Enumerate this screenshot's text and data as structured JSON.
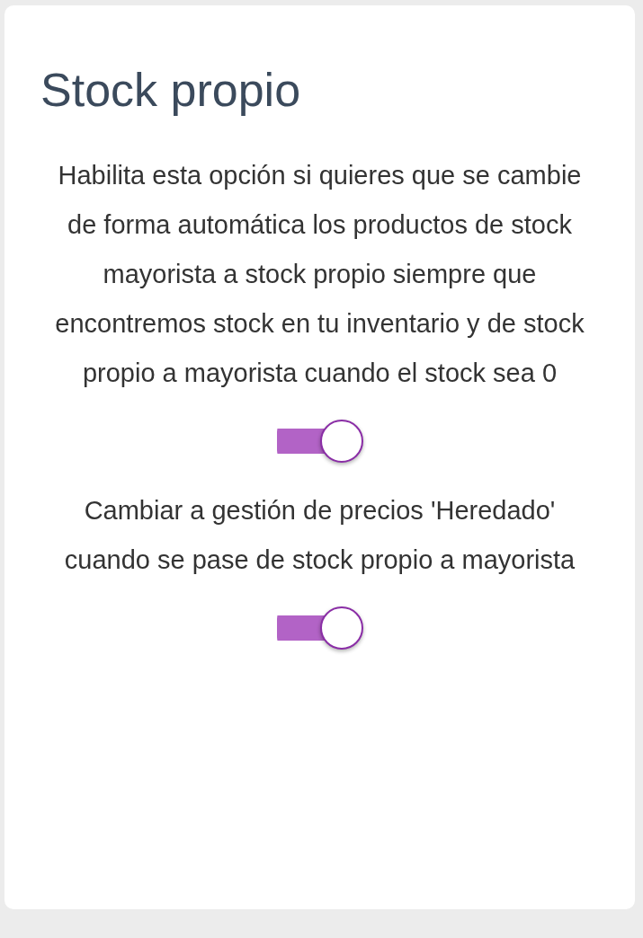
{
  "card": {
    "title": "Stock propio",
    "options": [
      {
        "description": "Habilita esta opción si quieres que se cambie de forma automática los productos de stock mayorista a stock propio siempre que encontremos stock en tu inventario y de stock propio a mayorista cuando el stock sea 0",
        "on": true
      },
      {
        "description": "Cambiar a gestión de precios 'Heredado' cuando se pase de stock propio a mayorista",
        "on": true
      }
    ]
  }
}
